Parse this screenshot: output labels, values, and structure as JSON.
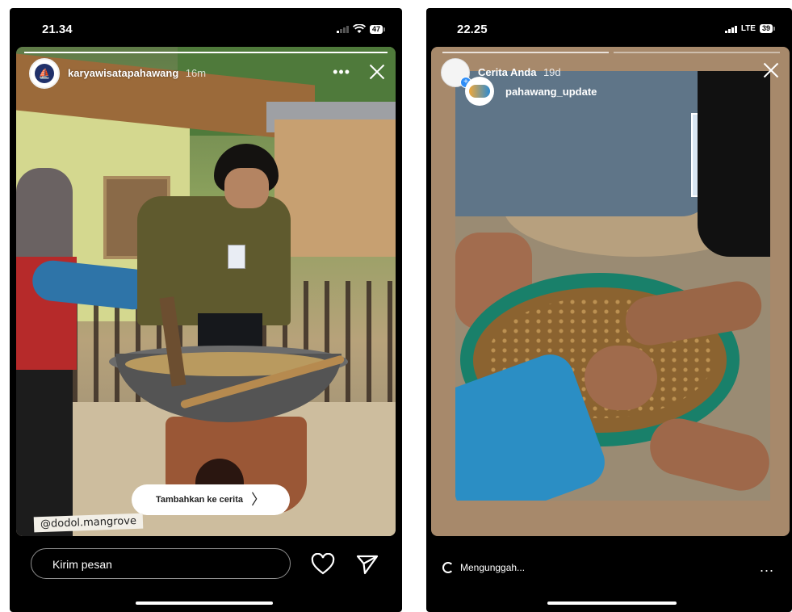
{
  "left_phone": {
    "status": {
      "time": "21.34",
      "battery": "47"
    },
    "story": {
      "username": "karyawisatapahawang",
      "time_ago": "16m",
      "add_to_story_label": "Tambahkan ke cerita",
      "mention_sticker": "@dodol.mangrove"
    },
    "bottom": {
      "message_placeholder": "Kirim pesan"
    }
  },
  "right_phone": {
    "status": {
      "time": "22.25",
      "network": "LTE",
      "battery": "39"
    },
    "story": {
      "username": "Cerita Anda",
      "time_ago": "19d",
      "reposted_account": "pahawang_update"
    },
    "bottom": {
      "upload_status": "Mengunggah...",
      "more_label": "..."
    }
  },
  "icons": {
    "signal": "cellular-signal-icon",
    "wifi": "wifi-icon",
    "battery": "battery-icon",
    "more": "more-dots-icon",
    "close": "close-icon",
    "chevron": "chevron-right-icon",
    "heart": "heart-icon",
    "send": "send-icon",
    "spinner": "loading-spinner-icon"
  }
}
